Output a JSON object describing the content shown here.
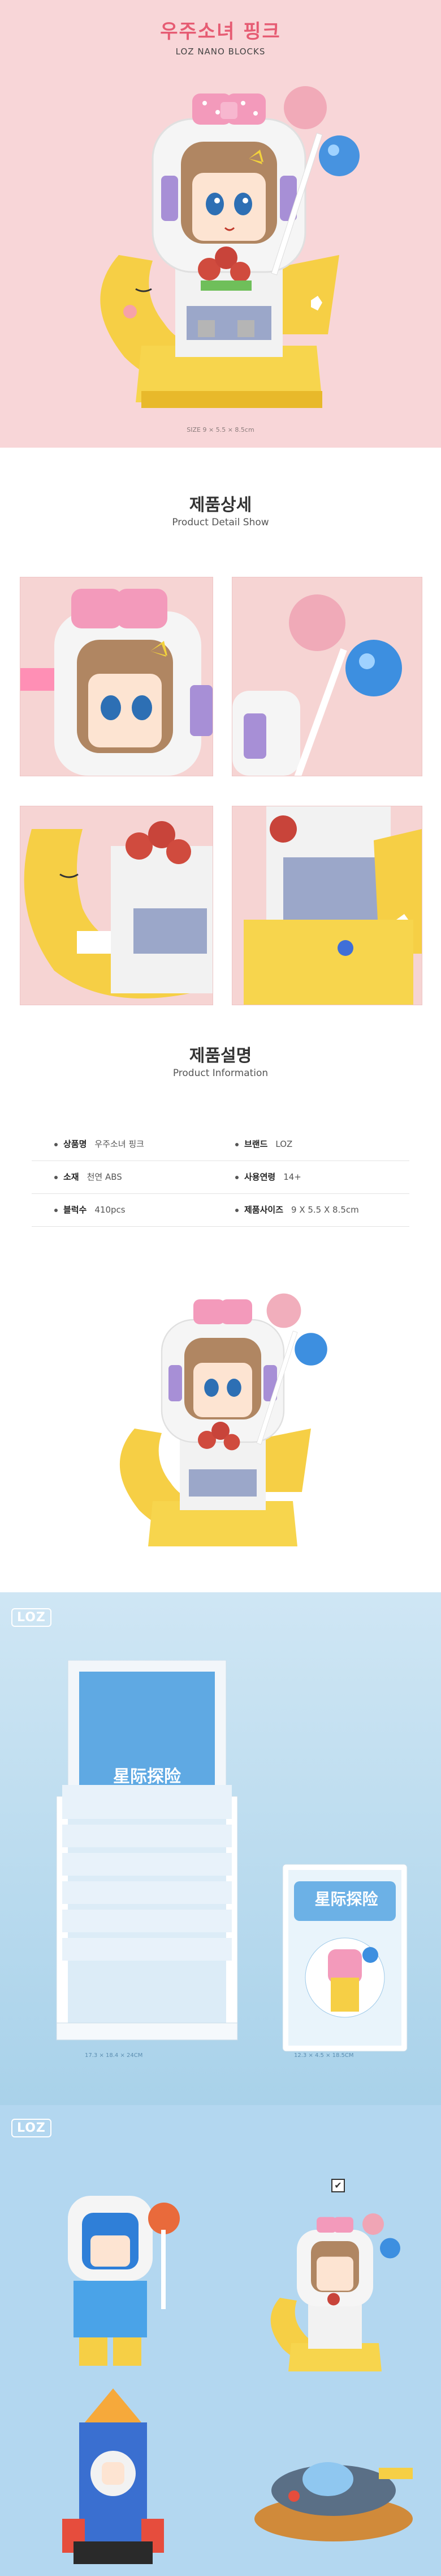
{
  "hero": {
    "title": "우주소녀 핑크",
    "subtitle": "LOZ NANO BLOCKS",
    "size_caption": "SIZE 9 × 5.5 × 8.5cm"
  },
  "detail": {
    "heading_ko": "제품상세",
    "heading_en": "Product Detail Show"
  },
  "info": {
    "heading_ko": "제품설명",
    "heading_en": "Product Information",
    "rows": [
      {
        "left_label": "상품명",
        "left_value": "우주소녀 핑크",
        "right_label": "브랜드",
        "right_value": "LOZ"
      },
      {
        "left_label": "소재",
        "left_value": "천연 ABS",
        "right_label": "사용연령",
        "right_value": "14+"
      },
      {
        "left_label": "블럭수",
        "left_value": "410pcs",
        "right_label": "제품사이즈",
        "right_value": "9 X 5.5 X 8.5cm"
      }
    ]
  },
  "boxsec": {
    "logo": "LOZ",
    "box_title": "星际探险",
    "box_cap_left": "17.3 × 18.4 × 24CM",
    "box_cap_right": "12.3 × 4.5 × 18.5CM"
  },
  "series": {
    "logo": "LOZ",
    "check_mark": "✔"
  },
  "colors": {
    "hero_bg": "#f8d6d8",
    "title_pink": "#e65c73",
    "box_bg": "#b9dcf0",
    "moon_yellow": "#f6cf45",
    "helmet_white": "#f2f2f2",
    "bow_pink": "#f39abb"
  }
}
